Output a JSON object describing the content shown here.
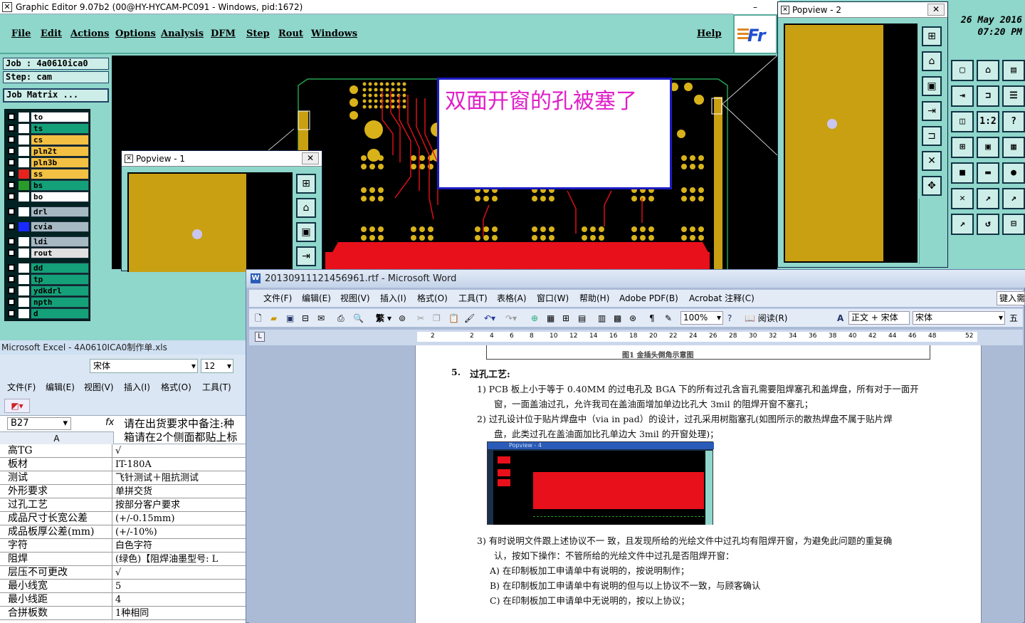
{
  "genesis": {
    "title": "Graphic Editor 9.07b2 (00@HY-HYCAM-PC091 - Windows, pid:1672)",
    "menu": [
      "File",
      "Edit",
      "Actions",
      "Options",
      "Analysis",
      "DFM",
      "Step",
      "Rout",
      "Windows"
    ],
    "help": "Help",
    "logo": "Fr",
    "date": "26 May 2016",
    "time": "07:20 PM",
    "job": "Job : 4a0610ica0",
    "step": "Step: cam",
    "job_matrix": "Job Matrix ...",
    "layers": [
      {
        "name": "to",
        "color": "#ffffff",
        "swatch": "#ffffff"
      },
      {
        "name": "ts",
        "color": "#14a078",
        "swatch": "#ffffff"
      },
      {
        "name": "cs",
        "color": "#f2c042",
        "swatch": "#ffffff"
      },
      {
        "name": "pln2t",
        "color": "#f2c042",
        "swatch": "#ffffff"
      },
      {
        "name": "pln3b",
        "color": "#f2c042",
        "swatch": "#ffffff"
      },
      {
        "name": "ss",
        "color": "#f2c042",
        "swatch": "#e8221c"
      },
      {
        "name": "bs",
        "color": "#14a078",
        "swatch": "#2a9a2a"
      },
      {
        "name": "bo",
        "color": "#ffffff",
        "swatch": "#ffffff"
      },
      {
        "name": "drl",
        "color": "#a6b8c2",
        "swatch": "#ffffff"
      },
      {
        "name": "cvia",
        "color": "#a6b8c2",
        "swatch": "#1a2aff"
      },
      {
        "name": "ldi",
        "color": "#a6b8c2",
        "swatch": "#ffffff"
      },
      {
        "name": "rout",
        "color": "#e0e0e0",
        "swatch": "#ffffff"
      },
      {
        "name": "dd",
        "color": "#14a078",
        "swatch": "#ffffff"
      },
      {
        "name": "tp",
        "color": "#14a078",
        "swatch": "#ffffff"
      },
      {
        "name": "ydkdrl",
        "color": "#14a078",
        "swatch": "#ffffff"
      },
      {
        "name": "npth",
        "color": "#14a078",
        "swatch": "#ffffff"
      },
      {
        "name": "d",
        "color": "#14a078",
        "swatch": "#ffffff"
      }
    ],
    "toolbox": [
      "▢",
      "⌂",
      "▤",
      "⇥",
      "⊐",
      "☰",
      "◫",
      "1:2",
      "?",
      "⊞",
      "▣",
      "▦",
      "■",
      "▬",
      "●",
      "✕",
      "↗",
      "↗",
      "↗",
      "↺",
      "⊟"
    ]
  },
  "popview1": {
    "title": "Popview - 1",
    "close": "✕"
  },
  "popview2": {
    "title": "Popview - 2",
    "close": "✕"
  },
  "callout": {
    "text": "双面开窗的孔被塞了"
  },
  "excel": {
    "title": "Microsoft Excel - 4A0610ICA0制作单.xls",
    "font": "宋体",
    "size": "12",
    "menu": [
      "文件(F)",
      "编辑(E)",
      "视图(V)",
      "插入(I)",
      "格式(O)",
      "工具(T)"
    ],
    "cell_ref": "B27",
    "formula_line1": "请在出货要求中备注:种",
    "formula_line2": "箱请在2个侧面都贴上标",
    "col_a": "A",
    "rows": [
      [
        "高TG",
        "√"
      ],
      [
        "板材",
        "IT-180A"
      ],
      [
        "测试",
        "飞针测试＋阻抗测试"
      ],
      [
        "外形要求",
        "单拼交货"
      ],
      [
        "过孔工艺",
        "按部分客户要求"
      ],
      [
        "成品尺寸长宽公差",
        "(+/-0.15mm)"
      ],
      [
        "成品板厚公差(mm)",
        "(+/-10%)"
      ],
      [
        "字符",
        "白色字符"
      ],
      [
        "阻焊",
        "(绿色)【阻焊油墨型号: L"
      ],
      [
        "层压不可更改",
        "√"
      ],
      [
        "最小线宽",
        "5"
      ],
      [
        "最小线距",
        "4"
      ],
      [
        "合拼板数",
        "1种相同"
      ]
    ]
  },
  "word": {
    "title": "20130911121456961.rtf - Microsoft Word",
    "menu": [
      "文件(F)",
      "编辑(E)",
      "视图(V)",
      "插入(I)",
      "格式(O)",
      "工具(T)",
      "表格(A)",
      "窗口(W)",
      "帮助(H)",
      "Adobe PDF(B)",
      "Acrobat 注释(C)"
    ],
    "help_box": "键入需",
    "zoom": "100%",
    "read_btn": "阅读(R)",
    "style": "正文 + 宋体",
    "font": "宋体",
    "trad": "繁",
    "five": "五",
    "ruler": [
      "2",
      "2",
      "4",
      "6",
      "8",
      "10",
      "12",
      "14",
      "16",
      "18",
      "20",
      "22",
      "24",
      "26",
      "28",
      "30",
      "32",
      "34",
      "36",
      "38",
      "40",
      "42",
      "44",
      "46",
      "48",
      "52"
    ],
    "fig_caption": "图1   金插头倒角示意图",
    "heading_no": "5.",
    "heading": "过孔工艺:",
    "p1a": "1) PCB 板上小于等于 0.40MM 的过电孔及 BGA 下的所有过孔含盲孔需要阻焊塞孔和盖焊盘，所有对于一面开",
    "p1b": "窗，一面盖油过孔，允许我司在盖油面增加单边比孔大 3mil 的阻焊开窗不塞孔；",
    "p2a": "2) 过孔设计位于贴片焊盘中（via in pad）的设计，过孔采用树脂塞孔(如图所示的散热焊盘不属于贴片焊",
    "p2b": "盘，此类过孔在盖油面加比孔单边大 3mil 的开窗处理)；",
    "inner_title": "Popview - 4",
    "p3a": "3) 有时说明文件跟上述协议不一 致，且发现所给的光绘文件中过孔均有阻焊开窗，为避免此问题的重复确",
    "p3b": "认，按如下操作：不管所给的光绘文件中过孔是否阻焊开窗：",
    "pA": "A) 在印制板加工申请单中有说明的，按说明制作；",
    "pB": "B) 在印制板加工申请单中有说明的但与以上协议不一致，与顾客确认",
    "pC": "C) 在印制板加工申请单中无说明的，按以上协议；"
  }
}
